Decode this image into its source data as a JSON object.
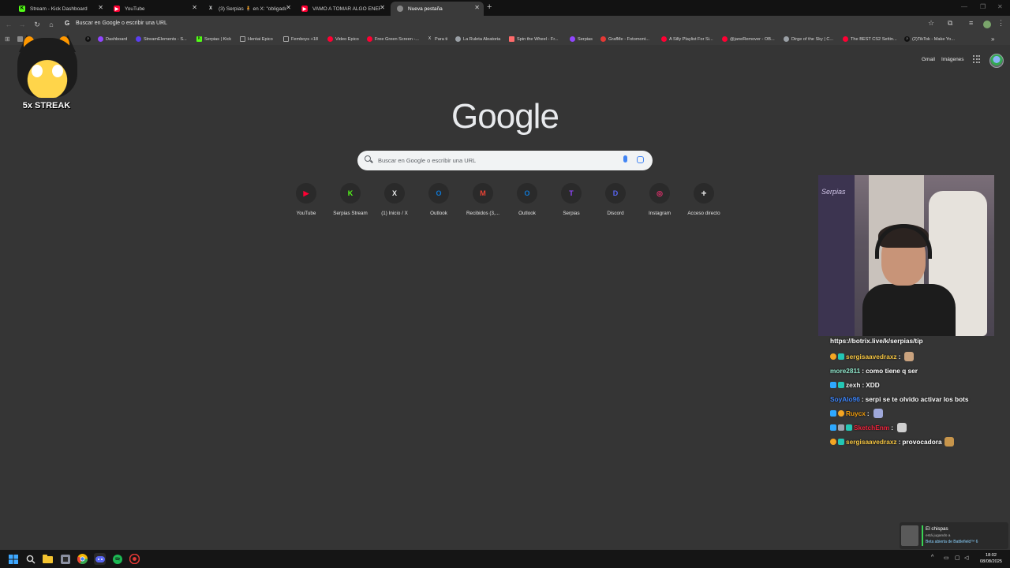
{
  "tabs": [
    {
      "title": "Stream - Kick Dashboard",
      "icon": "kick-icon",
      "color": "#53fc18",
      "active": false
    },
    {
      "title": "YouTube",
      "icon": "youtube-icon",
      "color": "#ff0033",
      "active": false
    },
    {
      "title": "(3) Serpias 🧍 en X: \"obligado",
      "icon": "x-icon",
      "color": "#e7e9ea",
      "active": false
    },
    {
      "title": "VAMO A TOMAR ALGO ENERGI",
      "icon": "youtube-icon",
      "color": "#ff0033",
      "active": false
    },
    {
      "title": "Nueva pestaña",
      "icon": "chrome-icon",
      "color": "#bdbdbd",
      "active": true
    }
  ],
  "omnibox": {
    "text": "Buscar en Google o escribir una URL"
  },
  "bookmarks": [
    {
      "label": "",
      "icon": "tiktok-icon",
      "color": "#111111"
    },
    {
      "label": "Dashboard",
      "icon": "twitch-icon",
      "color": "#9146ff"
    },
    {
      "label": "StreamElements - S...",
      "icon": "streamelements-icon",
      "color": "#5a3ff0"
    },
    {
      "label": "Serpias | Kick",
      "icon": "kick-icon",
      "color": "#53fc18"
    },
    {
      "label": "Hentai Epico",
      "icon": "folder-icon",
      "color": "#8a8a8a"
    },
    {
      "label": "Femboys +18",
      "icon": "folder-icon",
      "color": "#8a8a8a"
    },
    {
      "label": "Video Epico",
      "icon": "youtube-icon",
      "color": "#ff0033"
    },
    {
      "label": "Free Green Screen -...",
      "icon": "youtube-icon",
      "color": "#ff0033"
    },
    {
      "label": "Para ti",
      "icon": "x-icon",
      "color": "#e7e9ea"
    },
    {
      "label": "La Ruleta Aleatoria",
      "icon": "globe-icon",
      "color": "#9aa0a6"
    },
    {
      "label": "Spin the Wheel - Fr...",
      "icon": "wheel-icon",
      "color": "#ff6b6b"
    },
    {
      "label": "Serpias",
      "icon": "twitch-icon",
      "color": "#9146ff"
    },
    {
      "label": "GrafMe - Fotomont...",
      "icon": "grafme-icon",
      "color": "#e53935"
    },
    {
      "label": "A Silly Playlist For Si...",
      "icon": "youtube-icon",
      "color": "#ff0033"
    },
    {
      "label": "@janeRemover - OB...",
      "icon": "youtube-icon",
      "color": "#ff0033"
    },
    {
      "label": "Dirge of the Sky | C...",
      "icon": "globe-icon",
      "color": "#9aa0a6"
    },
    {
      "label": "The BEST CS2 Settin...",
      "icon": "youtube-icon",
      "color": "#ff0033"
    },
    {
      "label": "(2)TikTok - Make Yo...",
      "icon": "tiktok-icon",
      "color": "#111111"
    }
  ],
  "header": {
    "gmail": "Gmail",
    "images": "Imágenes"
  },
  "logo": "Google",
  "search": {
    "placeholder": "Buscar en Google o escribir una URL"
  },
  "shortcuts": [
    {
      "label": "YouTube",
      "icon": "youtube-icon",
      "color": "#ff0033",
      "glyph": "▶"
    },
    {
      "label": "Serpias Stream",
      "icon": "kick-icon",
      "color": "#53fc18",
      "glyph": "K"
    },
    {
      "label": "(1) Inicio / X",
      "icon": "x-icon",
      "color": "#e7e9ea",
      "glyph": "X"
    },
    {
      "label": "Outlook",
      "icon": "outlook-icon",
      "color": "#0f78d4",
      "glyph": "O"
    },
    {
      "label": "Recibidos (3,...",
      "icon": "gmail-icon",
      "color": "#ea4335",
      "glyph": "M"
    },
    {
      "label": "Outlook",
      "icon": "outlook-icon",
      "color": "#0f78d4",
      "glyph": "O"
    },
    {
      "label": "Serpias",
      "icon": "twitch-icon",
      "color": "#9146ff",
      "glyph": "T"
    },
    {
      "label": "Discord",
      "icon": "discord-icon",
      "color": "#5865f2",
      "glyph": "D"
    },
    {
      "label": "Instagram",
      "icon": "instagram-icon",
      "color": "#e1306c",
      "glyph": "◎"
    },
    {
      "label": "Acceso directo",
      "icon": "plus-icon",
      "color": "#e3e3e3",
      "glyph": "+"
    }
  ],
  "streak": {
    "label": "5x STREAK"
  },
  "webcam": {
    "poster_text": "Serpias"
  },
  "chat": {
    "link": "https://botrix.live/k/serpias/tip",
    "messages": [
      {
        "user": "sergisaavedraxz",
        "user_color": "#f5c542",
        "text": "",
        "emote": "#c9a27e",
        "badges": [
          "#f5a623",
          "#23c7b5"
        ]
      },
      {
        "user": "more2811",
        "user_color": "#8ee3c8",
        "text": "como tiene q ser",
        "emote": "",
        "badges": []
      },
      {
        "user": "zexh",
        "user_color": "#f0f0f0",
        "text": "XDD",
        "emote": "",
        "badges": [
          "#2ea8ff",
          "#23c7b5"
        ]
      },
      {
        "user": "SoyAlo96",
        "user_color": "#3b82f6",
        "text": "serpi se te olvido activar los bots",
        "emote": "",
        "badges": []
      },
      {
        "user": "Ruycx",
        "user_color": "#f59e0b",
        "text": "",
        "emote": "#9fa8da",
        "badges": [
          "#2ea8ff",
          "#f5a623"
        ]
      },
      {
        "user": "SketchEnm",
        "user_color": "#ef233c",
        "text": "",
        "emote": "#cfcfcf",
        "badges": [
          "#2ea8ff",
          "#9ca3af",
          "#23c7b5"
        ]
      },
      {
        "user": "sergisaavedraxz",
        "user_color": "#f5c542",
        "text": "provocadora",
        "emote": "#c7954b",
        "badges": [
          "#f5a623",
          "#23c7b5"
        ]
      }
    ]
  },
  "notification": {
    "title": "El chispas",
    "subtitle": "está jugando a",
    "game": "Beta abierta de Battlefield™ 6"
  },
  "clock": {
    "time": "18:02",
    "date": "08/08/2025"
  },
  "taskbar_icons": [
    {
      "icon": "windows-start-icon",
      "color": "#3ea8ff"
    },
    {
      "icon": "search-icon",
      "color": "#e0e0e0"
    },
    {
      "icon": "file-explorer-icon",
      "color": "#f4c430"
    },
    {
      "icon": "app-icon",
      "color": "#8a8fa0"
    },
    {
      "icon": "chrome-icon",
      "color": "#f2b705"
    },
    {
      "icon": "discord-icon",
      "color": "#5865f2"
    },
    {
      "icon": "spotify-icon",
      "color": "#1db954"
    },
    {
      "icon": "chrome-red-icon",
      "color": "#e53935"
    }
  ]
}
